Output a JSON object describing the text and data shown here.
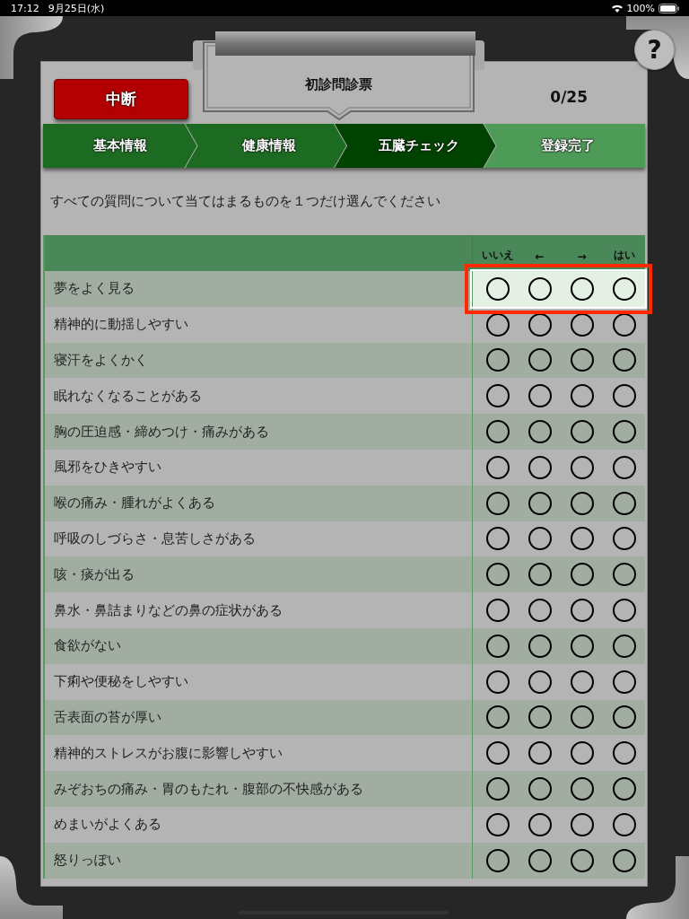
{
  "status_bar": {
    "time": "17:12",
    "date": "9月25日(水)",
    "battery": "100%"
  },
  "header": {
    "abort_button": "中断",
    "title": "初診問診票",
    "progress": "0/25",
    "help_button": "?"
  },
  "steps": [
    {
      "label": "基本情報",
      "done": true,
      "selected": false
    },
    {
      "label": "健康情報",
      "done": true,
      "selected": false
    },
    {
      "label": "五臓チェック",
      "done": false,
      "selected": true
    },
    {
      "label": "登録完了",
      "done": false,
      "selected": false
    }
  ],
  "instruction": "すべての質問について当てはまるものを１つだけ選んでください",
  "table": {
    "columns": [
      "いいえ",
      "←",
      "→",
      "はい"
    ],
    "rows": [
      {
        "question": "夢をよく見る",
        "current": true,
        "options": [
          {
            "selected": false
          },
          {
            "selected": false
          },
          {
            "selected": false
          },
          {
            "selected": false
          }
        ]
      },
      {
        "question": "精神的に動揺しやすい",
        "current": false,
        "options": [
          {
            "selected": false
          },
          {
            "selected": false
          },
          {
            "selected": false
          },
          {
            "selected": false
          }
        ]
      },
      {
        "question": "寝汗をよくかく",
        "current": false,
        "options": [
          {
            "selected": false
          },
          {
            "selected": false
          },
          {
            "selected": false
          },
          {
            "selected": false
          }
        ]
      },
      {
        "question": "眠れなくなることがある",
        "current": false,
        "options": [
          {
            "selected": false
          },
          {
            "selected": false
          },
          {
            "selected": false
          },
          {
            "selected": false
          }
        ]
      },
      {
        "question": "胸の圧迫感・締めつけ・痛みがある",
        "current": false,
        "options": [
          {
            "selected": false
          },
          {
            "selected": false
          },
          {
            "selected": false
          },
          {
            "selected": false
          }
        ]
      },
      {
        "question": "風邪をひきやすい",
        "current": false,
        "options": [
          {
            "selected": false
          },
          {
            "selected": false
          },
          {
            "selected": false
          },
          {
            "selected": false
          }
        ]
      },
      {
        "question": "喉の痛み・腫れがよくある",
        "current": false,
        "options": [
          {
            "selected": false
          },
          {
            "selected": false
          },
          {
            "selected": false
          },
          {
            "selected": false
          }
        ]
      },
      {
        "question": "呼吸のしづらさ・息苦しさがある",
        "current": false,
        "options": [
          {
            "selected": false
          },
          {
            "selected": false
          },
          {
            "selected": false
          },
          {
            "selected": false
          }
        ]
      },
      {
        "question": "咳・痰が出る",
        "current": false,
        "options": [
          {
            "selected": false
          },
          {
            "selected": false
          },
          {
            "selected": false
          },
          {
            "selected": false
          }
        ]
      },
      {
        "question": "鼻水・鼻詰まりなどの鼻の症状がある",
        "current": false,
        "options": [
          {
            "selected": false
          },
          {
            "selected": false
          },
          {
            "selected": false
          },
          {
            "selected": false
          }
        ]
      },
      {
        "question": "食欲がない",
        "current": false,
        "options": [
          {
            "selected": false
          },
          {
            "selected": false
          },
          {
            "selected": false
          },
          {
            "selected": false
          }
        ]
      },
      {
        "question": "下痢や便秘をしやすい",
        "current": false,
        "options": [
          {
            "selected": false
          },
          {
            "selected": false
          },
          {
            "selected": false
          },
          {
            "selected": false
          }
        ]
      },
      {
        "question": "舌表面の苔が厚い",
        "current": false,
        "options": [
          {
            "selected": false
          },
          {
            "selected": false
          },
          {
            "selected": false
          },
          {
            "selected": false
          }
        ]
      },
      {
        "question": "精神的ストレスがお腹に影響しやすい",
        "current": false,
        "options": [
          {
            "selected": false
          },
          {
            "selected": false
          },
          {
            "selected": false
          },
          {
            "selected": false
          }
        ]
      },
      {
        "question": "みぞおちの痛み・胃のもたれ・腹部の不快感がある",
        "current": false,
        "options": [
          {
            "selected": false
          },
          {
            "selected": false
          },
          {
            "selected": false
          },
          {
            "selected": false
          }
        ]
      },
      {
        "question": "めまいがよくある",
        "current": false,
        "options": [
          {
            "selected": false
          },
          {
            "selected": false
          },
          {
            "selected": false
          },
          {
            "selected": false
          }
        ]
      },
      {
        "question": "怒りっぽい",
        "current": false,
        "options": [
          {
            "selected": false
          },
          {
            "selected": false
          },
          {
            "selected": false
          },
          {
            "selected": false
          }
        ]
      }
    ]
  }
}
